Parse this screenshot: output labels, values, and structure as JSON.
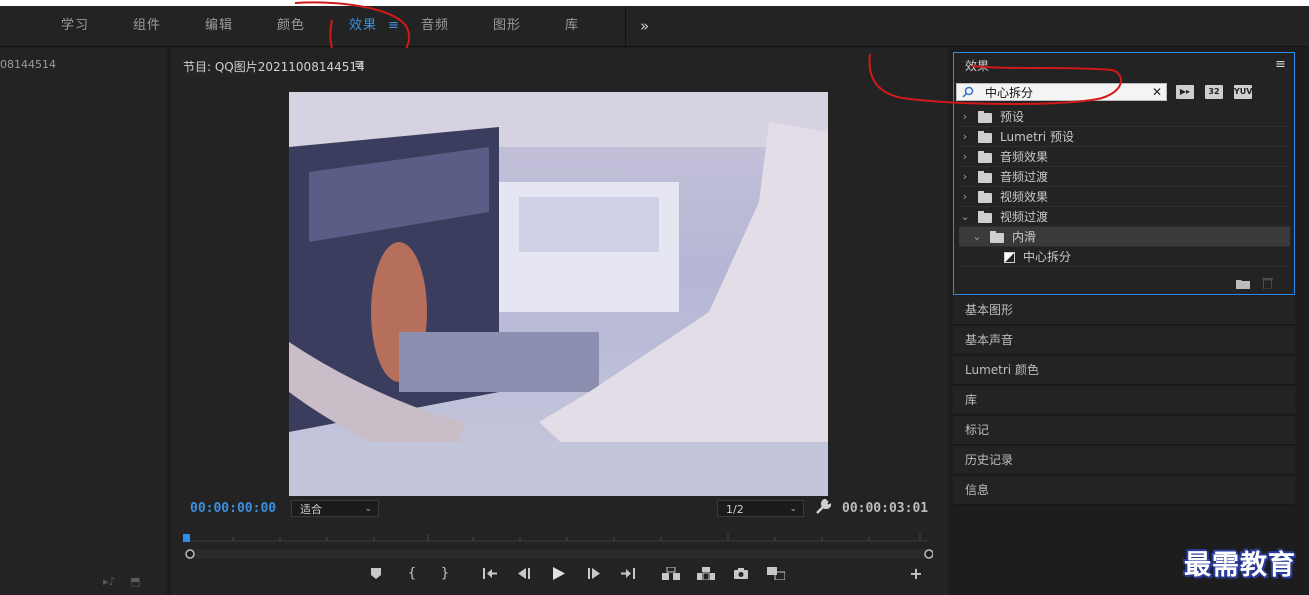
{
  "workspace": {
    "tabs": [
      {
        "label": "学习"
      },
      {
        "label": "组件"
      },
      {
        "label": "编辑"
      },
      {
        "label": "颜色"
      },
      {
        "label": "效果",
        "active": true
      },
      {
        "label": "音频"
      },
      {
        "label": "图形"
      },
      {
        "label": "库"
      }
    ],
    "overflow": "»",
    "active_color": "#3b8fe0"
  },
  "project_panel": {
    "title": "08144514"
  },
  "program_monitor": {
    "title": "节目: QQ图片20211008144514",
    "menu_icon": "≡",
    "current_timecode": "00:00:00:00",
    "duration_timecode": "00:00:03:01",
    "zoom": "适合",
    "resolution": "1/2",
    "controls": [
      "marker-icon",
      "mark-in-icon",
      "mark-out-icon",
      "go-to-in-icon",
      "step-back-icon",
      "play-icon",
      "step-forward-icon",
      "go-to-out-icon",
      "insert-icon",
      "overwrite-icon",
      "export-frame-icon",
      "compare-icon",
      "add-button-icon"
    ]
  },
  "effects_panel": {
    "title": "效果",
    "search_value": "中心拆分",
    "badges": [
      "32",
      "YUV"
    ],
    "tree": [
      {
        "label": "预设",
        "expanded": false,
        "type": "preset"
      },
      {
        "label": "Lumetri 预设",
        "expanded": false,
        "type": "preset"
      },
      {
        "label": "音频效果",
        "expanded": false,
        "type": "folder"
      },
      {
        "label": "音频过渡",
        "expanded": false,
        "type": "folder"
      },
      {
        "label": "视频效果",
        "expanded": false,
        "type": "folder"
      },
      {
        "label": "视频过渡",
        "expanded": true,
        "type": "folder"
      },
      {
        "label": "内滑",
        "expanded": true,
        "type": "folder",
        "selected": true
      },
      {
        "label": "中心拆分",
        "type": "effect"
      }
    ]
  },
  "side_panels": [
    "基本图形",
    "基本声音",
    "Lumetri 颜色",
    "库",
    "标记",
    "历史记录",
    "信息"
  ],
  "watermark": "最需教育"
}
